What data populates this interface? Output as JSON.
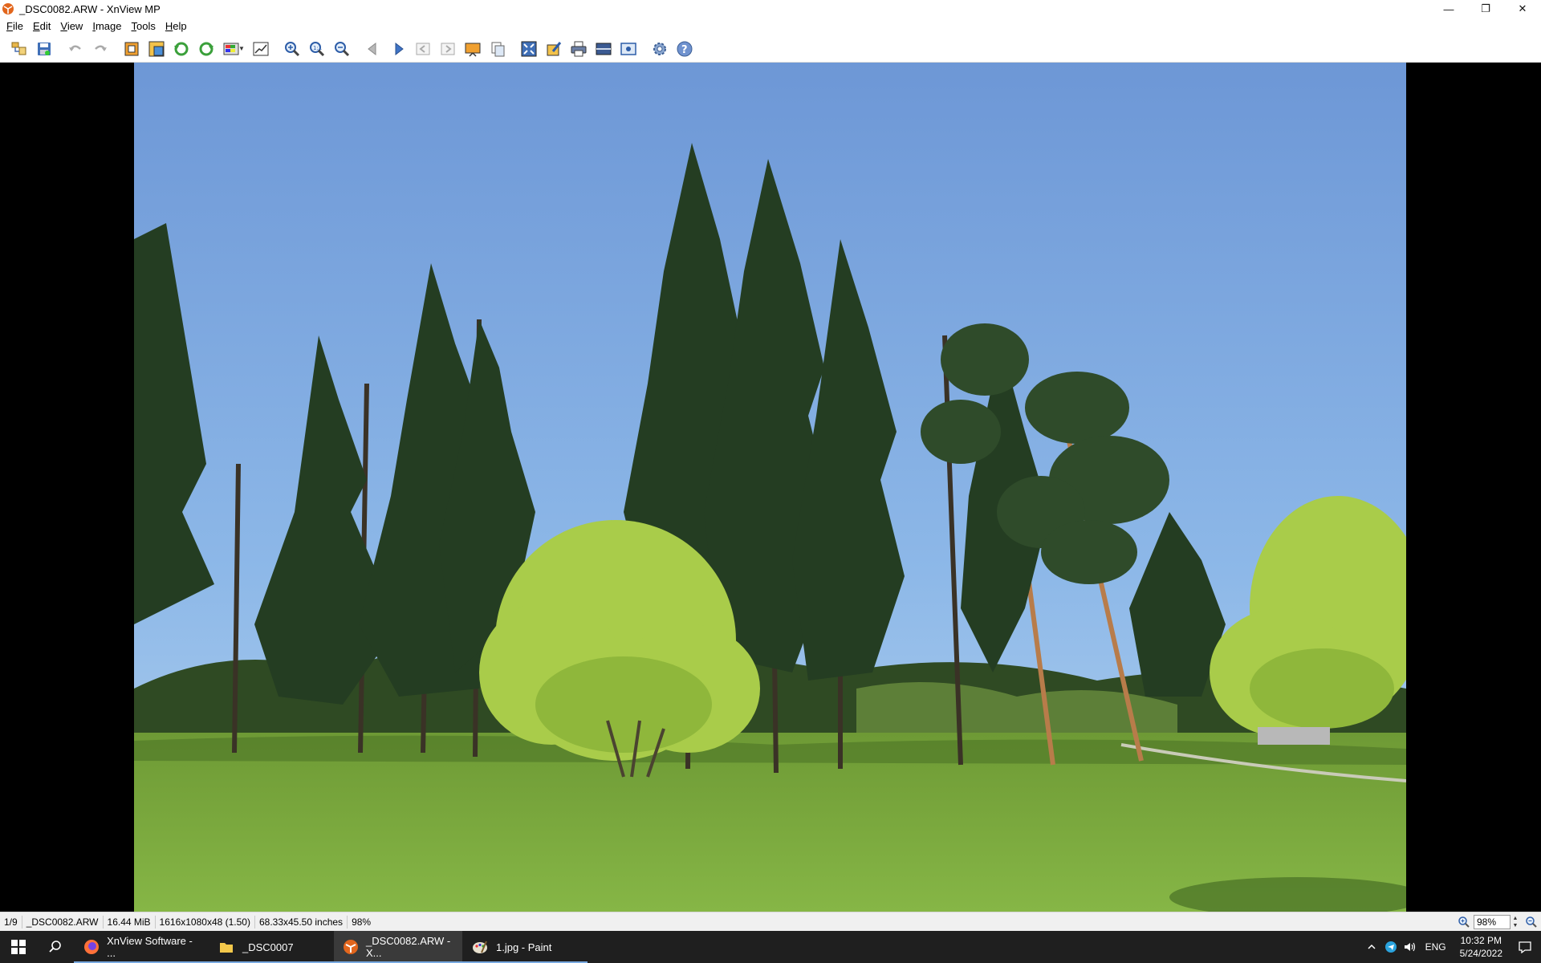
{
  "window": {
    "title": "_DSC0082.ARW - XnView MP",
    "minimize": "—",
    "restore": "❐",
    "close": "✕"
  },
  "menu": [
    {
      "label": "File",
      "key": "F",
      "rest": "ile"
    },
    {
      "label": "Edit",
      "key": "E",
      "rest": "dit"
    },
    {
      "label": "View",
      "key": "V",
      "rest": "iew"
    },
    {
      "label": "Image",
      "key": "I",
      "rest": "mage"
    },
    {
      "label": "Tools",
      "key": "T",
      "rest": "ools"
    },
    {
      "label": "Help",
      "key": "H",
      "rest": "elp"
    }
  ],
  "toolbar": {
    "icons": [
      "browser-icon",
      "save-icon",
      "undo-icon",
      "redo-icon",
      "crop-icon",
      "resize-icon",
      "rotate-left-icon",
      "rotate-right-icon",
      "adjust-icon",
      "levels-icon",
      "zoom-in-icon",
      "zoom-actual-icon",
      "zoom-out-icon",
      "previous-icon",
      "next-icon",
      "first-icon",
      "last-icon",
      "slideshow-icon",
      "copy-icon",
      "fit-icon",
      "edit-icon",
      "print-icon",
      "scan-icon",
      "wallpaper-icon",
      "settings-icon",
      "help-icon"
    ]
  },
  "status": {
    "index": "1/9",
    "filename": "_DSC0082.ARW",
    "size": "16.44 MiB",
    "dimensions": "1616x1080x48 (1.50)",
    "print_size": "68.33x45.50 inches",
    "zoom_pct": "98%",
    "zoom_input": "98%"
  },
  "taskbar": {
    "items": [
      {
        "label": "XnView Software - ...",
        "icon": "firefox-icon",
        "active": false
      },
      {
        "label": "_DSC0007",
        "icon": "folder-icon",
        "active": false
      },
      {
        "label": "_DSC0082.ARW - X...",
        "icon": "xnview-icon",
        "active": true
      },
      {
        "label": "1.jpg - Paint",
        "icon": "paint-icon",
        "active": false
      }
    ],
    "lang": "ENG",
    "time": "10:32 PM",
    "date": "5/24/2022"
  },
  "colors": {
    "sky_top": "#5f8fd0",
    "sky_bottom": "#9cc3ec",
    "grass": "#7fae3c",
    "conifer": "#243d22",
    "birch": "#a9cc4a"
  }
}
